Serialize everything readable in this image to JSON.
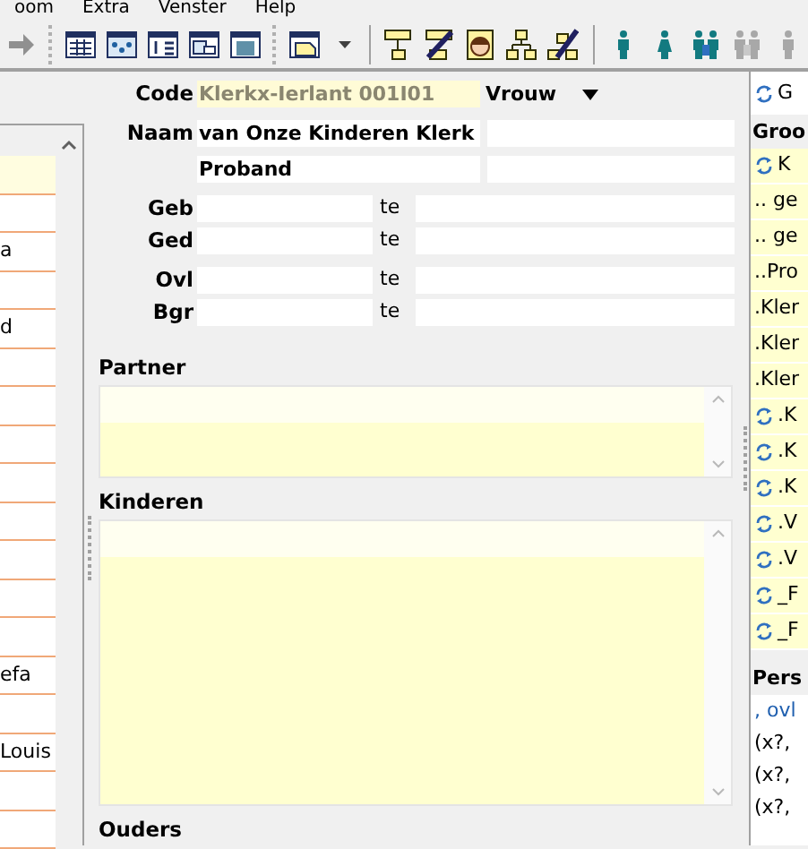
{
  "menu": [
    "oom",
    "Extra",
    "Venster",
    "Help"
  ],
  "toolbar": [
    {
      "kind": "arrow",
      "disabled": true
    },
    {
      "kind": "grip"
    },
    {
      "kind": "table",
      "disabled": false
    },
    {
      "kind": "dots-window",
      "disabled": false
    },
    {
      "kind": "numbered-list",
      "disabled": false
    },
    {
      "kind": "window",
      "disabled": false
    },
    {
      "kind": "film",
      "disabled": false
    },
    {
      "kind": "grip"
    },
    {
      "kind": "note-window",
      "disabled": false
    },
    {
      "kind": "caret",
      "disabled": false
    },
    {
      "kind": "separator"
    },
    {
      "kind": "tree",
      "disabled": false
    },
    {
      "kind": "tree-slash",
      "disabled": false
    },
    {
      "kind": "avatar",
      "disabled": false
    },
    {
      "kind": "hierarchy",
      "disabled": false
    },
    {
      "kind": "hierarchy-slash",
      "disabled": false
    },
    {
      "kind": "separator"
    },
    {
      "kind": "man",
      "disabled": false
    },
    {
      "kind": "woman",
      "disabled": false
    },
    {
      "kind": "couple",
      "disabled": false
    },
    {
      "kind": "couple",
      "disabled": true
    },
    {
      "kind": "man",
      "disabled": true
    }
  ],
  "left_list": [
    {
      "selected": true
    },
    {
      "selected": false
    },
    {
      "text": "a",
      "selected": false
    },
    {
      "selected": false
    },
    {
      "text": "d",
      "selected": false
    },
    {
      "selected": false
    },
    {
      "selected": false
    },
    {
      "selected": false
    },
    {
      "selected": false
    },
    {
      "selected": false
    },
    {
      "selected": false
    },
    {
      "selected": false
    },
    {
      "selected": false
    },
    {
      "text": "efa",
      "selected": false
    },
    {
      "selected": false
    },
    {
      "text": "Louis",
      "selected": false
    },
    {
      "selected": false
    },
    {
      "selected": false
    }
  ],
  "form": {
    "code": {
      "label": "Code",
      "value": "Klerkx-Ierlant 001I01"
    },
    "sex": {
      "value": "Vrouw"
    },
    "name": {
      "label": "Naam",
      "value": "van Onze Kinderen Klerk"
    },
    "given": {
      "value": "Proband"
    },
    "events": [
      {
        "label": "Geb",
        "place_label": "te"
      },
      {
        "label": "Ged",
        "place_label": "te"
      },
      {
        "label": "Ovl",
        "place_label": "te"
      },
      {
        "label": "Bgr",
        "place_label": "te"
      }
    ]
  },
  "sections": [
    {
      "title": "Partner",
      "kind": "short-list"
    },
    {
      "title": "Kinderen",
      "kind": "long-list"
    },
    {
      "title": "Ouders",
      "kind": "heading-only"
    }
  ],
  "right": {
    "top": {
      "text": "G",
      "linked": true
    },
    "header": "Groo",
    "rows": [
      {
        "text": "K",
        "linked": true
      },
      {
        "text": ".. ge",
        "linked": false
      },
      {
        "text": ".. ge",
        "linked": false
      },
      {
        "text": "..Pro",
        "linked": false
      },
      {
        "text": ".Kler",
        "linked": false
      },
      {
        "text": ".Kler",
        "linked": false
      },
      {
        "text": ".Kler",
        "linked": false
      },
      {
        "text": ".K",
        "linked": true
      },
      {
        "text": ".K",
        "linked": true
      },
      {
        "text": ".K",
        "linked": true
      },
      {
        "text": ".V",
        "linked": true
      },
      {
        "text": ".V",
        "linked": true
      },
      {
        "text": "_F",
        "linked": true
      },
      {
        "text": "_F",
        "linked": true
      }
    ],
    "persons_header": "Pers",
    "persons": [
      {
        "text": ", ovl",
        "kind": "link"
      },
      {
        "text": "(x?,",
        "kind": "plain"
      },
      {
        "text": "(x?,",
        "kind": "plain"
      },
      {
        "text": "(x?,",
        "kind": "plain"
      }
    ]
  }
}
